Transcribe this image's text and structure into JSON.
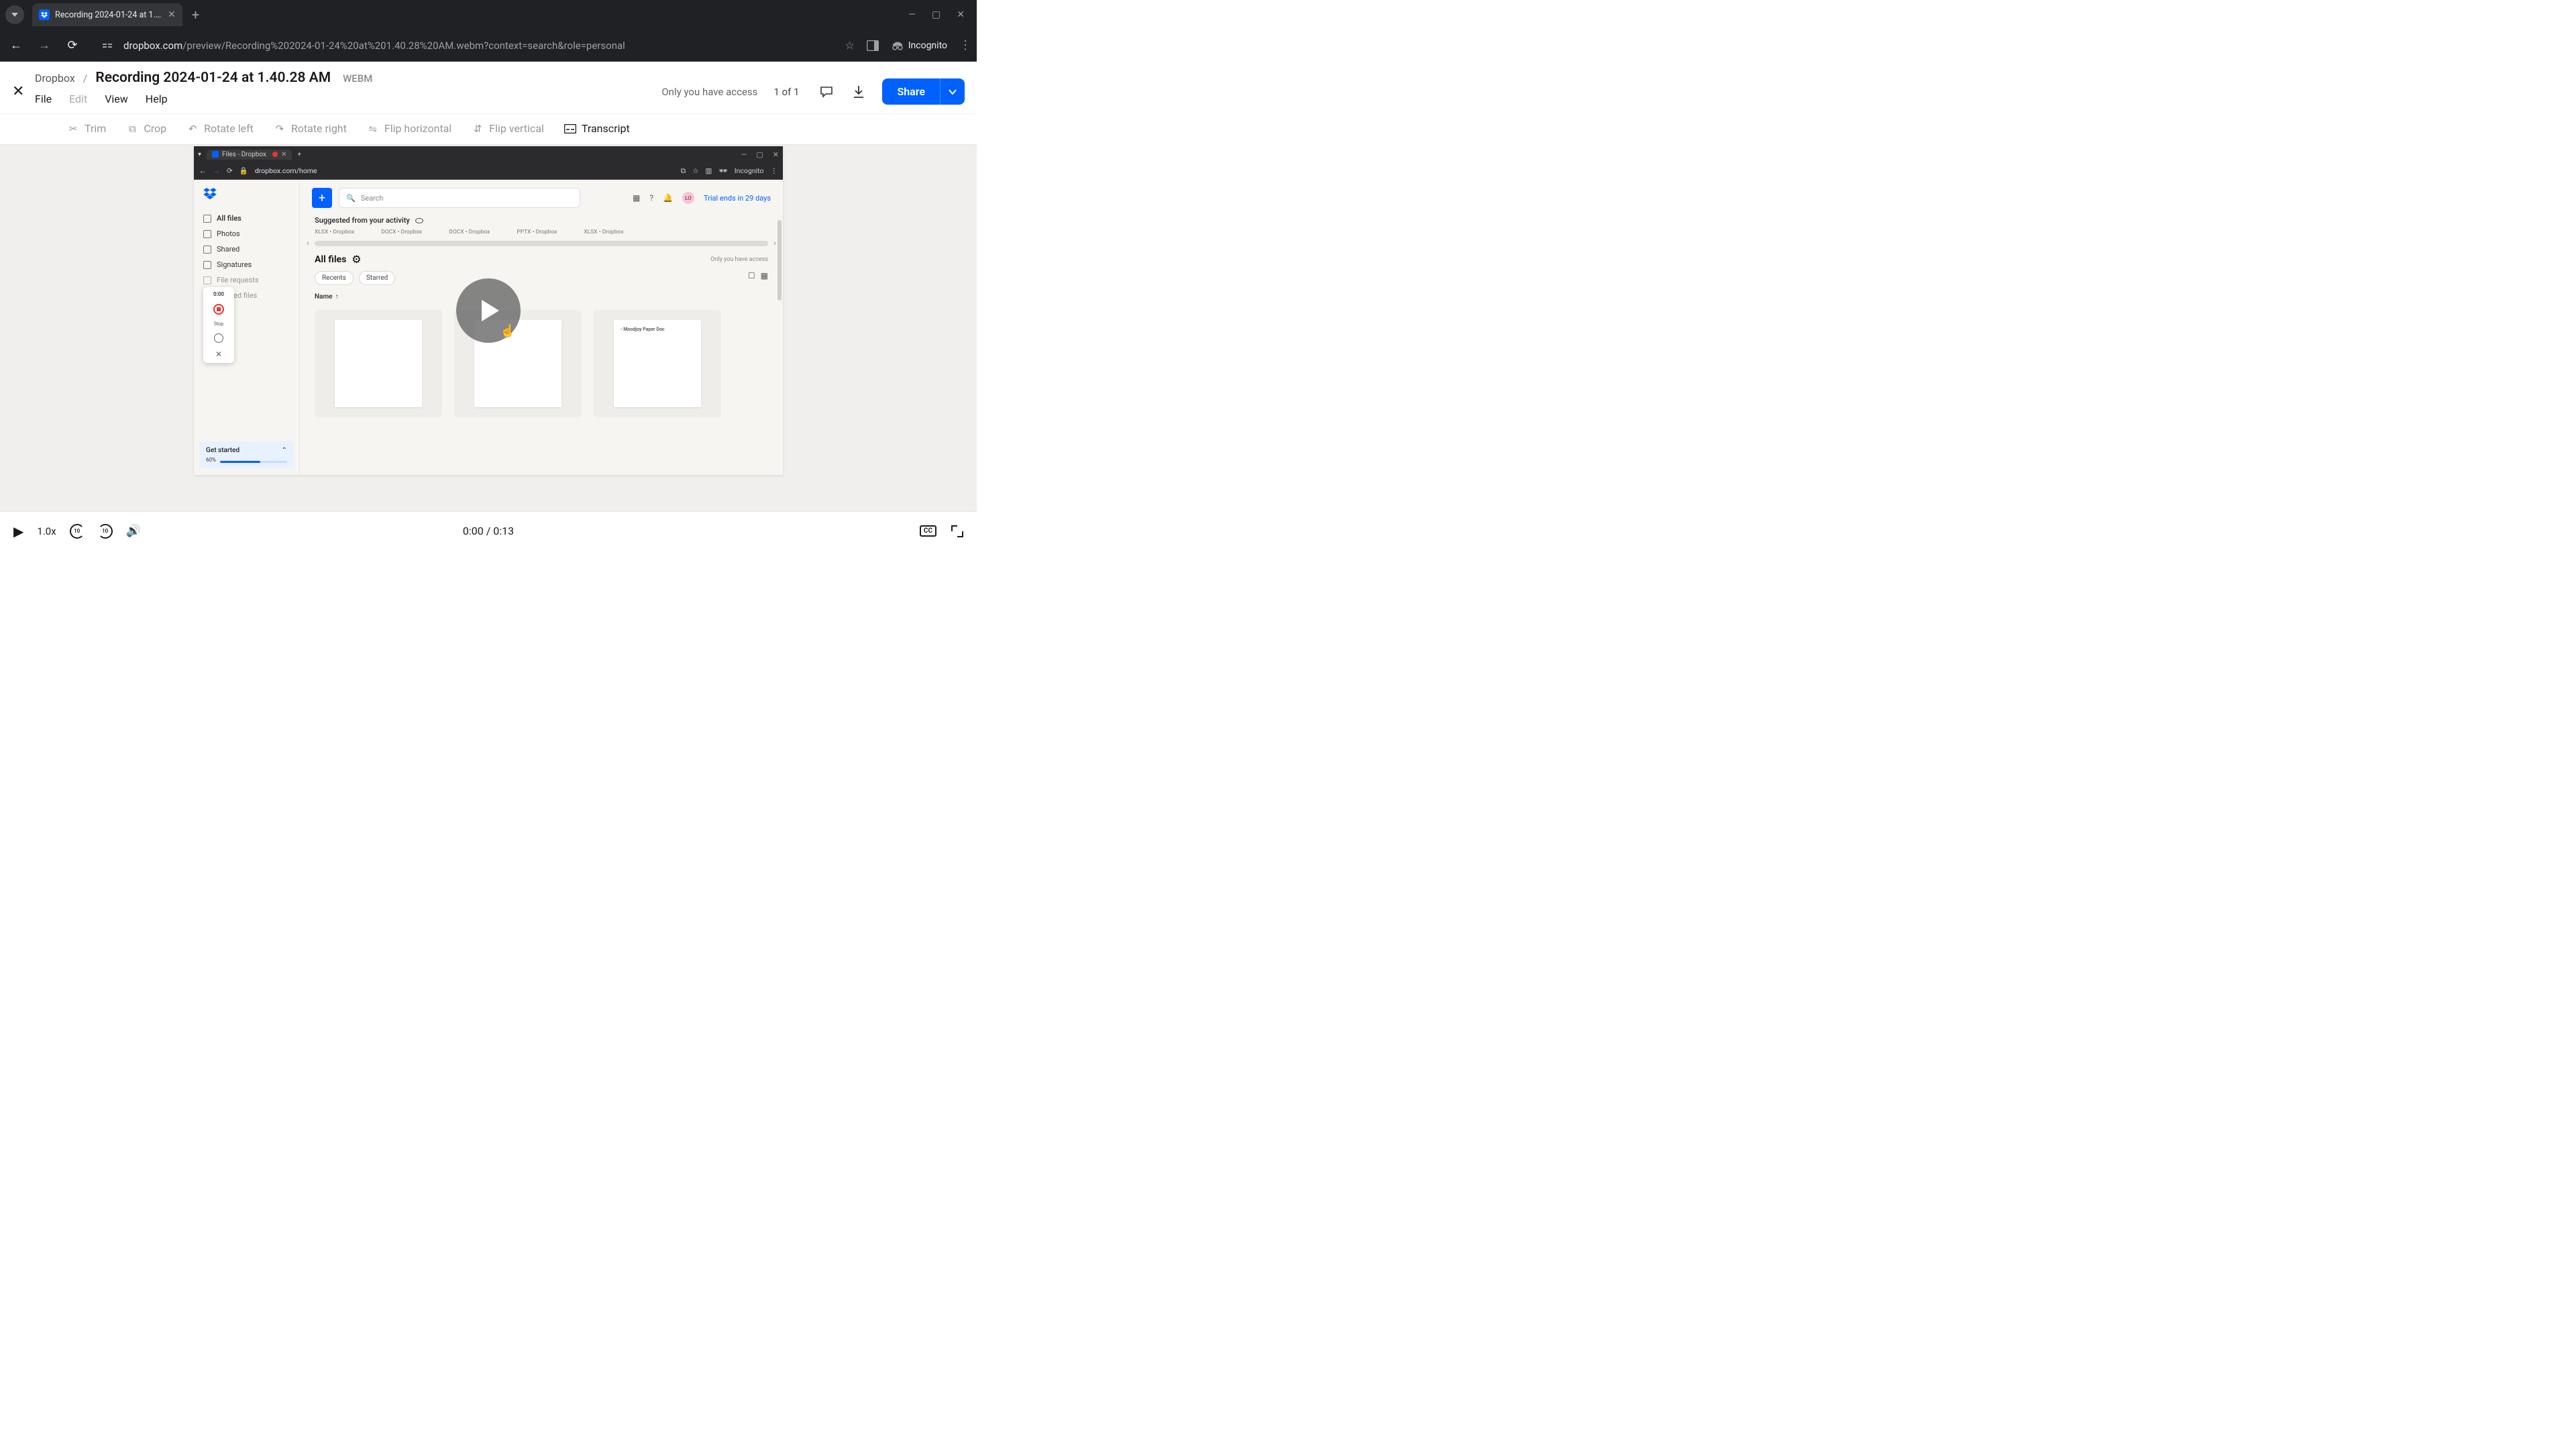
{
  "browser": {
    "tab_title": "Recording 2024-01-24 at 1.40.2…",
    "url_host": "dropbox.com",
    "url_path": "/preview/Recording%202024-01-24%20at%201.40.28%20AM.webm?context=search&role=personal",
    "incognito_label": "Incognito"
  },
  "preview": {
    "crumb_root": "Dropbox",
    "crumb_sep": "/",
    "title": "Recording 2024-01-24 at 1.40.28 AM",
    "ext": "WEBM",
    "access": "Only you have access",
    "counter": "1 of 1",
    "share": "Share",
    "menu": {
      "file": "File",
      "edit": "Edit",
      "view": "View",
      "help": "Help"
    }
  },
  "toolbar": {
    "trim": "Trim",
    "crop": "Crop",
    "rotate_left": "Rotate left",
    "rotate_right": "Rotate right",
    "flip_h": "Flip horizontal",
    "flip_v": "Flip vertical",
    "transcript": "Transcript"
  },
  "player": {
    "speed": "1.0x",
    "skip_back": "10",
    "skip_fwd": "10",
    "time": "0:00 / 0:13",
    "cc": "CC"
  },
  "inner": {
    "tab_title": "Files - Dropbox",
    "url": "dropbox.com/home",
    "incognito": "Incognito",
    "search_placeholder": "Search",
    "trial": "Trial ends in 29 days",
    "avatar": "LO",
    "sidebar": {
      "all_files": "All files",
      "photos": "Photos",
      "shared": "Shared",
      "signatures": "Signatures",
      "requests": "File requests",
      "deleted": "Deleted files"
    },
    "rec_popup": {
      "time": "0:00",
      "stop": "Stop"
    },
    "get_started": {
      "label": "Get started",
      "pct": "60%"
    },
    "suggested": "Suggested from your activity",
    "sug_items": [
      "XLSX • Dropbox",
      "DOCX • Dropbox",
      "DOCX • Dropbox",
      "PPTX • Dropbox",
      "XLSX • Dropbox"
    ],
    "all_files_h": "All files",
    "only_you": "Only you have access",
    "chips": {
      "recents": "Recents",
      "starred": "Starred"
    },
    "name_col": "Name",
    "card3_title": "- Moodjoy Paper Doc"
  }
}
